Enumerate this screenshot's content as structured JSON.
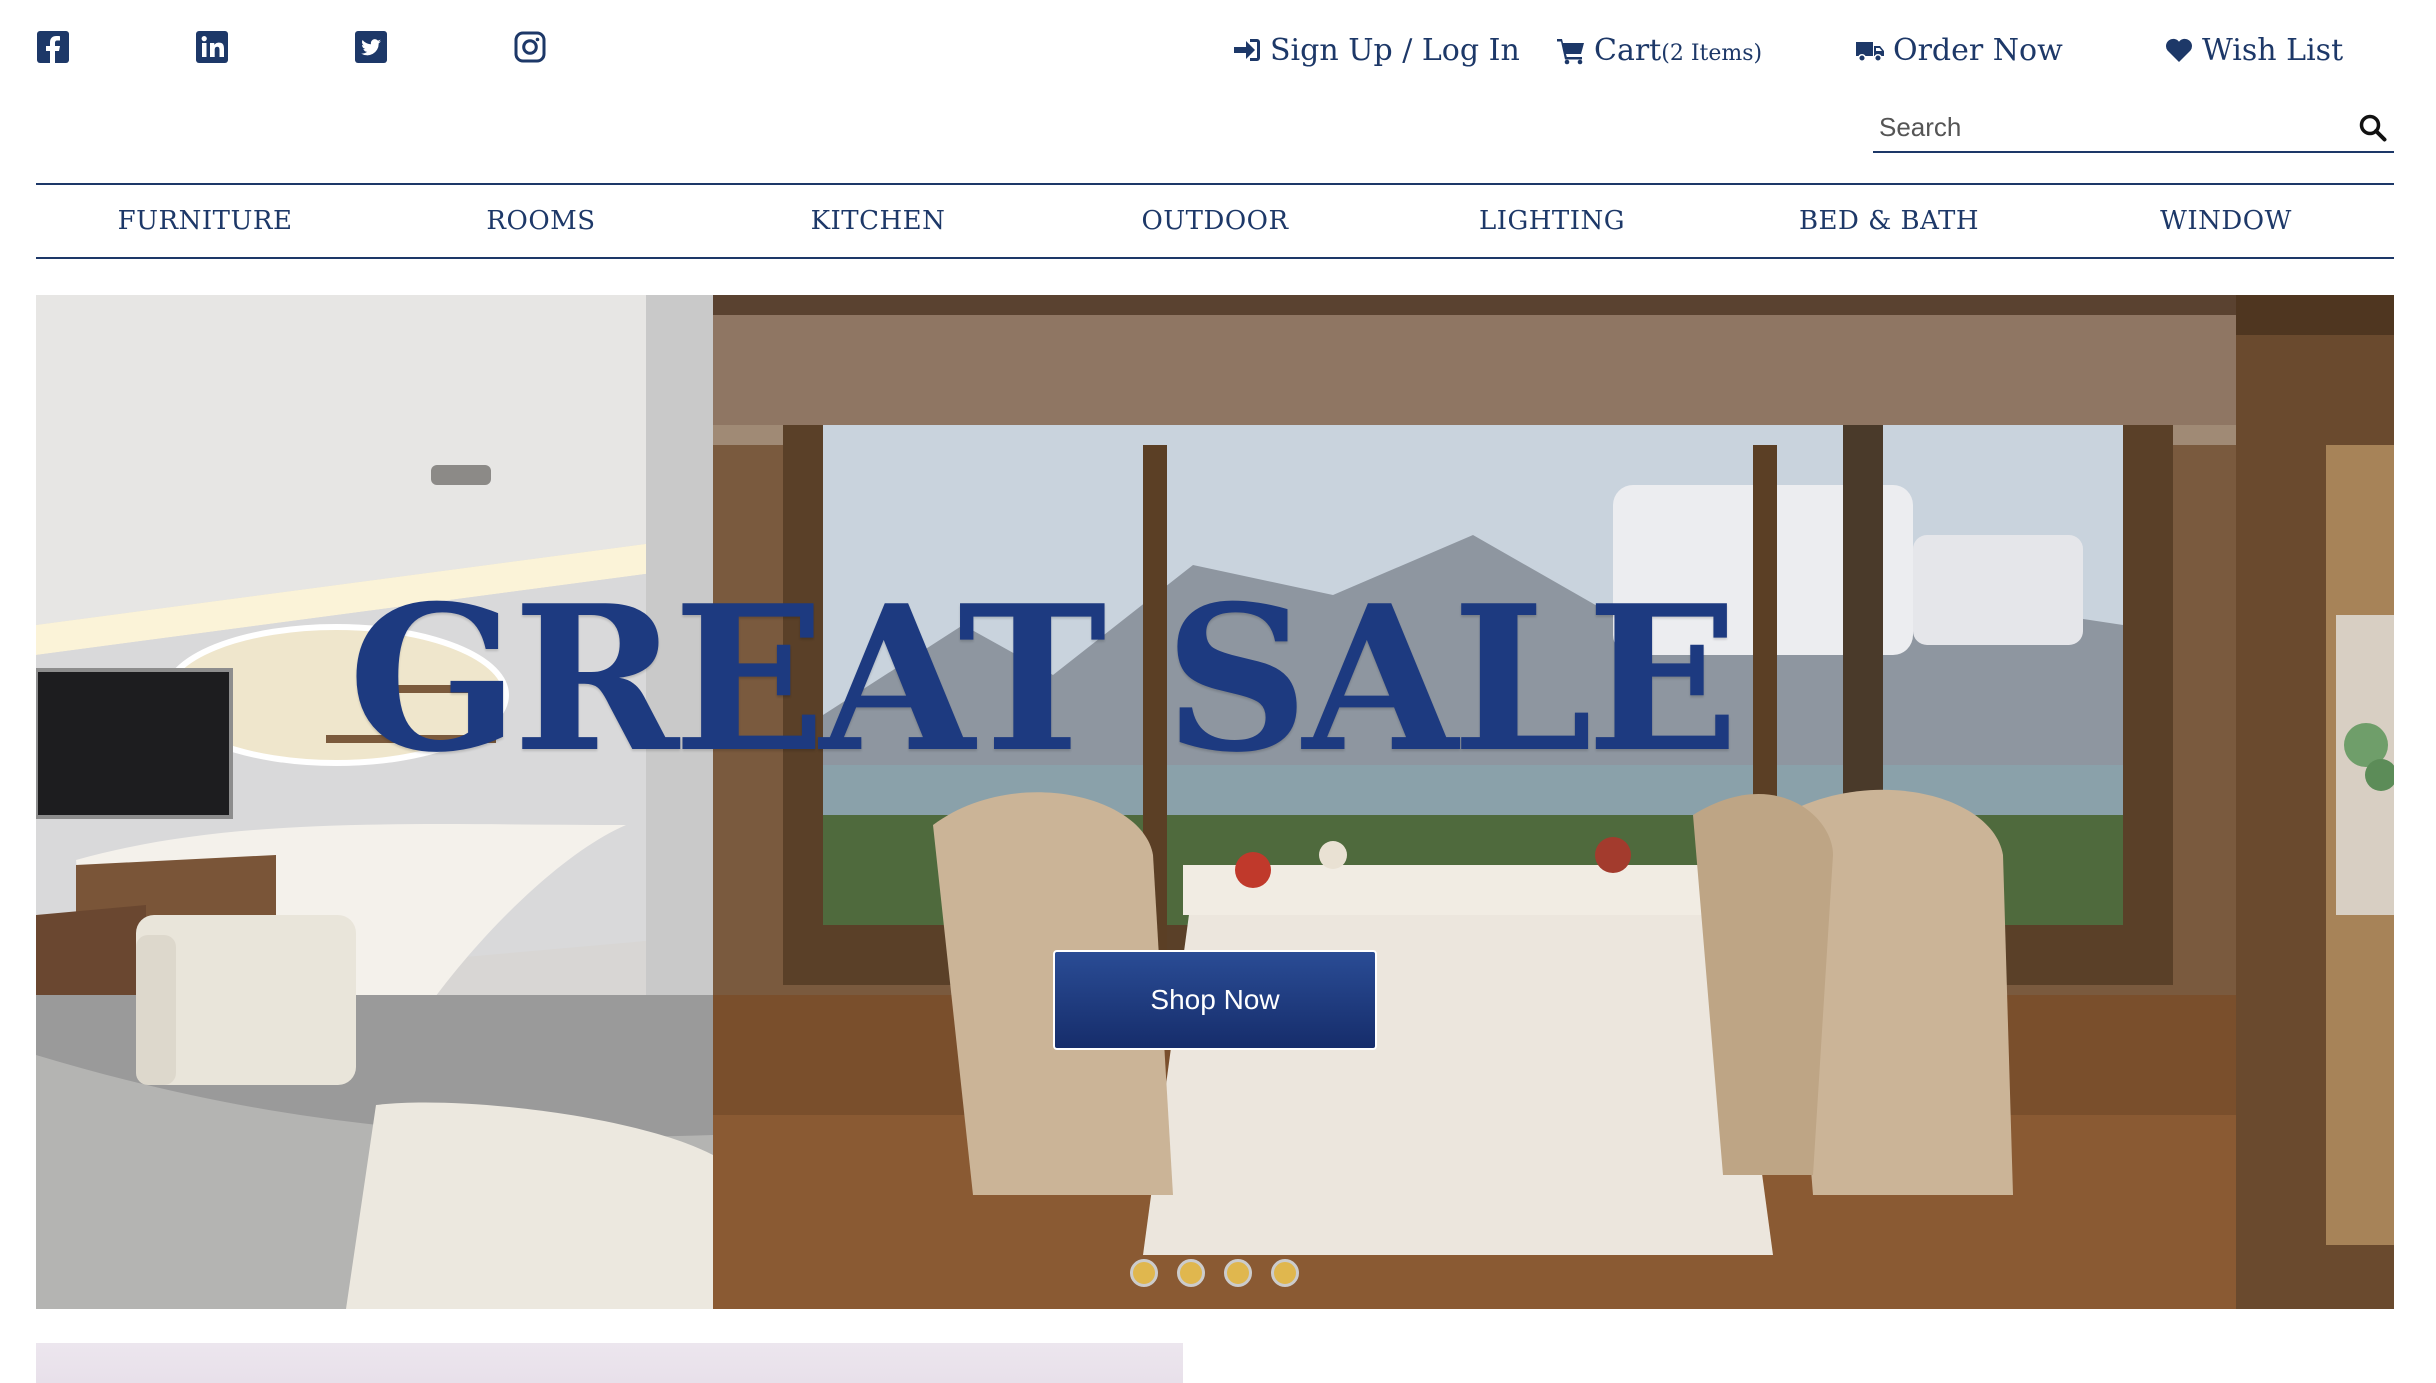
{
  "social": {
    "icons": [
      "facebook-icon",
      "linkedin-icon",
      "twitter-icon",
      "instagram-icon"
    ]
  },
  "account": {
    "signup_login": "Sign Up / Log In",
    "cart_label": "Cart",
    "cart_count": "(2 Items)",
    "order_now": "Order Now",
    "wish_list": "Wish List"
  },
  "search": {
    "placeholder": "Search"
  },
  "nav": {
    "items": [
      "FURNITURE",
      "ROOMS",
      "KITCHEN",
      "OUTDOOR",
      "LIGHTING",
      "BED & BATH",
      "WINDOW"
    ]
  },
  "hero": {
    "headline": "GREAT SALE",
    "cta_label": "Shop Now",
    "slide_count": 4
  },
  "colors": {
    "brand_navy": "#1d3868",
    "headline_blue": "#1d3a80",
    "dot_gold": "#e0b74e"
  }
}
